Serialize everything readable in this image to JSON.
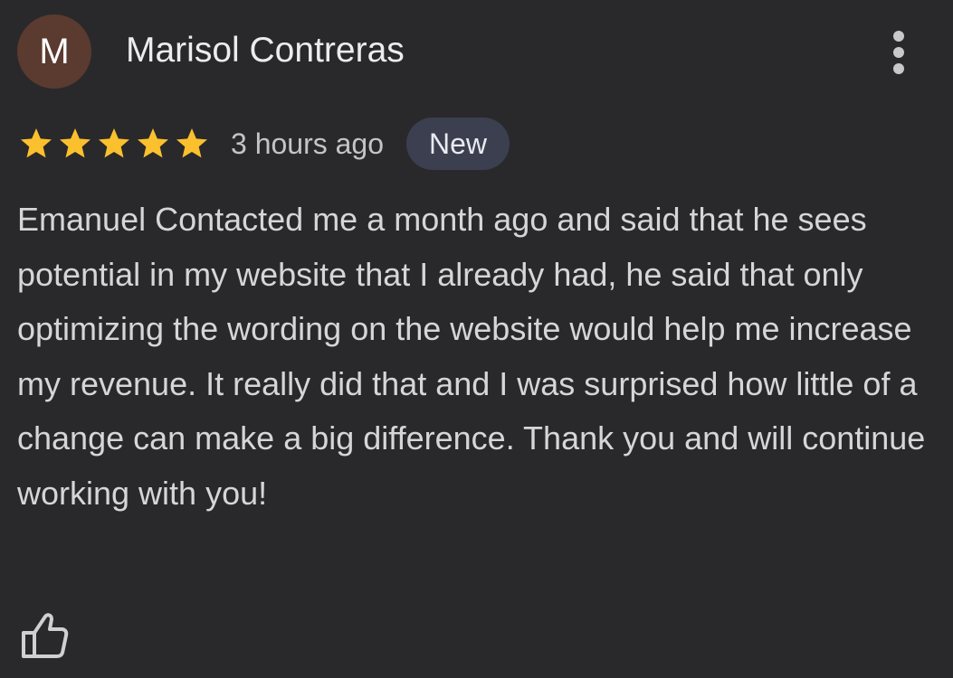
{
  "review": {
    "avatar_initial": "M",
    "avatar_color": "#5b3a2f",
    "reviewer_name": "Marisol Contreras",
    "rating": 5,
    "rating_max": 5,
    "star_color": "#fbc02d",
    "time_ago": "3 hours ago",
    "badge": "New",
    "text": "Emanuel Contacted me a month ago and said that he sees potential in my website that I already had, he said that only optimizing the wording on the website would help me increase my revenue. It really did that and I was surprised how little of a change can make a big difference. Thank you and will continue working with you!"
  },
  "icons": {
    "more": "more-vertical-icon",
    "star": "star-icon",
    "like": "thumbs-up-icon"
  },
  "colors": {
    "background": "#29292b",
    "badge_background": "#3b3f4f"
  }
}
